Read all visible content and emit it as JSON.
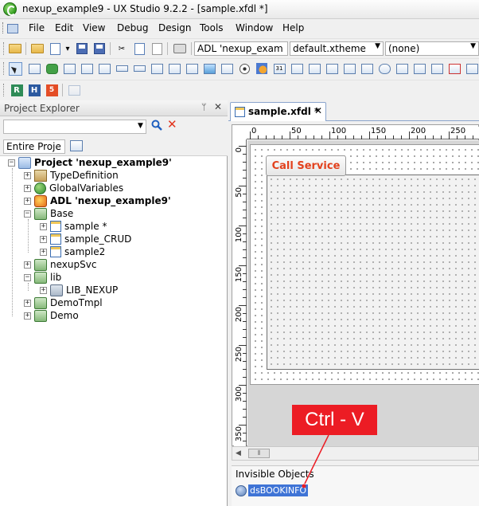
{
  "window": {
    "title": "nexup_example9 - UX Studio 9.2.2 - [sample.xfdl *]"
  },
  "menu": [
    "File",
    "Edit",
    "View",
    "Debug",
    "Design",
    "Tools",
    "Window",
    "Help"
  ],
  "toolbar": {
    "adl_combo": "ADL 'nexup_exam",
    "theme_combo": "default.xtheme",
    "none_combo": "(none)"
  },
  "project_explorer": {
    "title": "Project Explorer",
    "pin_glyph": "ᛘ",
    "close_glyph": "✕",
    "scope": "Entire Proje",
    "tree": [
      {
        "label": "Project 'nexup_example9'",
        "bold": true
      },
      {
        "label": "TypeDefinition"
      },
      {
        "label": "GlobalVariables"
      },
      {
        "label": "ADL 'nexup_example9'",
        "bold": true
      },
      {
        "label": "Base"
      },
      {
        "label": "sample *"
      },
      {
        "label": "sample_CRUD"
      },
      {
        "label": "sample2"
      },
      {
        "label": "nexupSvc"
      },
      {
        "label": "lib"
      },
      {
        "label": "LIB_NEXUP"
      },
      {
        "label": "DemoTmpl"
      },
      {
        "label": "Demo"
      }
    ]
  },
  "editor": {
    "tab_label": "sample.xfdl *",
    "tab_close": "✕",
    "ruler_top": [
      "0",
      "50",
      "100",
      "150",
      "200",
      "250"
    ],
    "ruler_left": [
      "0",
      "50",
      "100",
      "150",
      "200",
      "250",
      "300",
      "350"
    ],
    "call_service_label": "Call Service"
  },
  "invisible_objects": {
    "title": "Invisible Objects",
    "items": [
      "dsBOOKINFO"
    ]
  },
  "callout": {
    "text": "Ctrl - V"
  }
}
